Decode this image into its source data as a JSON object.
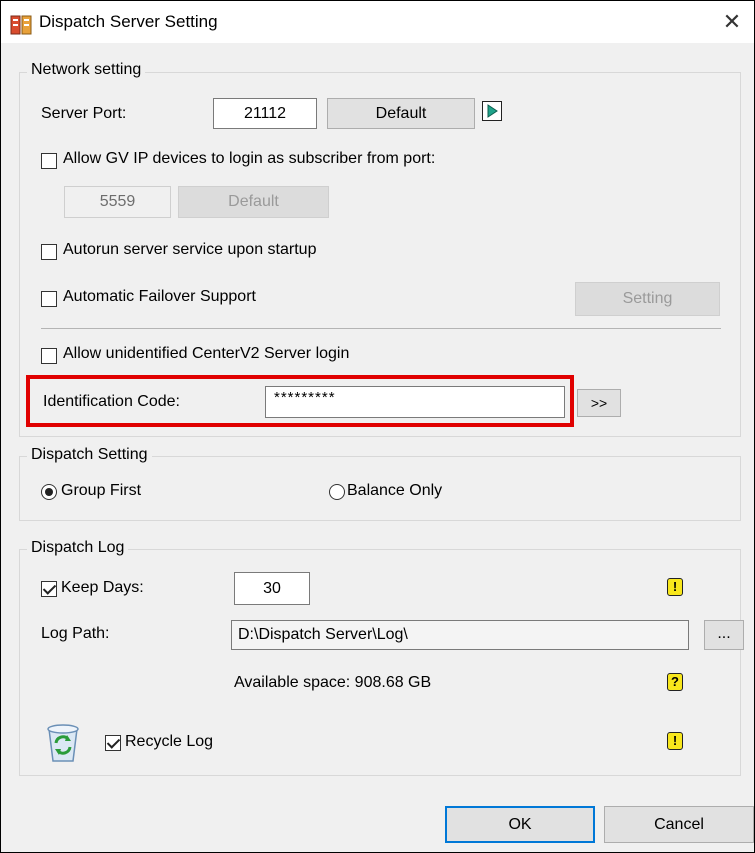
{
  "window": {
    "title": "Dispatch Server Setting",
    "close_glyph": "✕"
  },
  "network": {
    "title": "Network setting",
    "server_port_label": "Server Port:",
    "server_port_value": "21112",
    "default_label": "Default",
    "arrow_glyph": "▶",
    "allow_gv_label": "Allow GV IP devices to login as subscriber from port:",
    "gv_port_value": "5559",
    "gv_default_label": "Default",
    "autorun_label": "Autorun server service upon startup",
    "failover_label": "Automatic Failover Support",
    "setting_label": "Setting",
    "allow_unidentified_label": "Allow unidentified CenterV2 Server login",
    "id_code_label": "Identification Code:",
    "id_code_value": "*********",
    "id_more_label": ">>"
  },
  "dispatch": {
    "title": "Dispatch Setting",
    "group_first": "Group First",
    "balance_only": "Balance Only"
  },
  "log": {
    "title": "Dispatch Log",
    "keep_days_label": "Keep Days:",
    "keep_days_value": "30",
    "log_path_label": "Log Path:",
    "log_path_value": "D:\\Dispatch Server\\Log\\",
    "browse_label": "...",
    "available_space": "Available space: 908.68 GB",
    "recycle_label": "Recycle Log",
    "warn_glyph": "!",
    "help_glyph": "?"
  },
  "footer": {
    "ok": "OK",
    "cancel": "Cancel"
  },
  "colors": {
    "highlight": "#e00000",
    "ok_border": "#0078d7",
    "warning_bg": "#f8e71c"
  }
}
